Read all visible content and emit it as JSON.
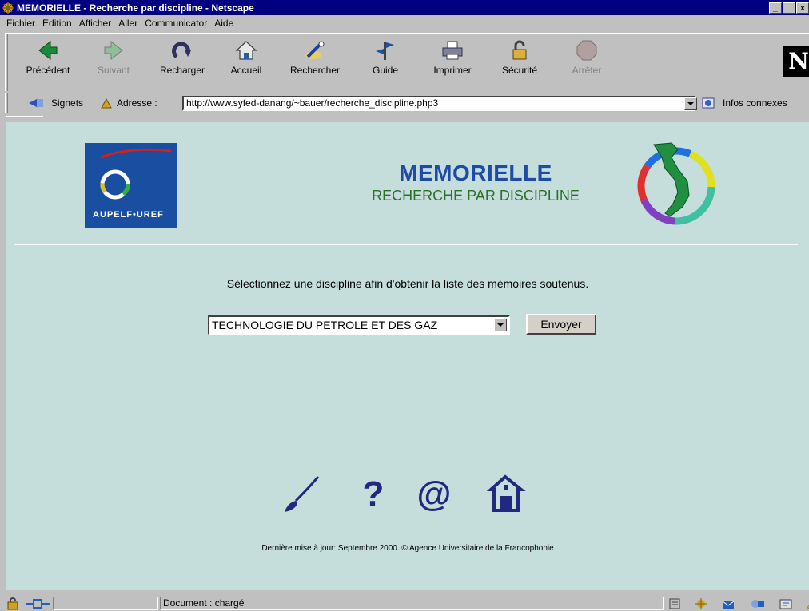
{
  "window": {
    "title": "MEMORIELLE - Recherche par discipline - Netscape",
    "controls": [
      "_",
      "□",
      "x"
    ]
  },
  "menu": {
    "items": [
      "Fichier",
      "Edition",
      "Afficher",
      "Aller",
      "Communicator",
      "Aide"
    ]
  },
  "toolbar": {
    "buttons": [
      {
        "label": "Précédent",
        "icon": "back-arrow-icon",
        "enabled": true
      },
      {
        "label": "Suivant",
        "icon": "forward-arrow-icon",
        "enabled": false
      },
      {
        "label": "Recharger",
        "icon": "reload-icon",
        "enabled": true
      },
      {
        "label": "Accueil",
        "icon": "home-icon",
        "enabled": true
      },
      {
        "label": "Rechercher",
        "icon": "search-icon",
        "enabled": true
      },
      {
        "label": "Guide",
        "icon": "guide-icon",
        "enabled": true
      },
      {
        "label": "Imprimer",
        "icon": "printer-icon",
        "enabled": true
      },
      {
        "label": "Sécurité",
        "icon": "lock-icon",
        "enabled": true
      },
      {
        "label": "Arrêter",
        "icon": "stop-icon",
        "enabled": false
      }
    ],
    "brand": "N"
  },
  "location": {
    "bookmarks_label": "Signets",
    "address_label": "Adresse :",
    "url": "http://www.syfed-danang/~bauer/recherche_discipline.php3",
    "related_label": "Infos connexes"
  },
  "page": {
    "left_logo_text": "AUPELF•UREF",
    "title": "MEMORIELLE",
    "subtitle": "RECHERCHE PAR DISCIPLINE",
    "instruction": "Sélectionnez une discipline afin d'obtenir la liste des mémoires soutenus.",
    "discipline_selected": "TECHNOLOGIE DU PETROLE ET DES GAZ",
    "submit_label": "Envoyer",
    "footer_icons": [
      "brush-icon",
      "help-question-icon",
      "email-at-icon",
      "house-icon"
    ],
    "footer": "Dernière mise à jour: Septembre 2000. © Agence Universitaire de la Francophonie"
  },
  "status": {
    "text": "Document : chargé"
  },
  "colors": {
    "titlebar": "#000080",
    "page_bg": "#c5dedb",
    "title_blue": "#1e4aa8",
    "subtitle_green": "#2d6e2d"
  }
}
